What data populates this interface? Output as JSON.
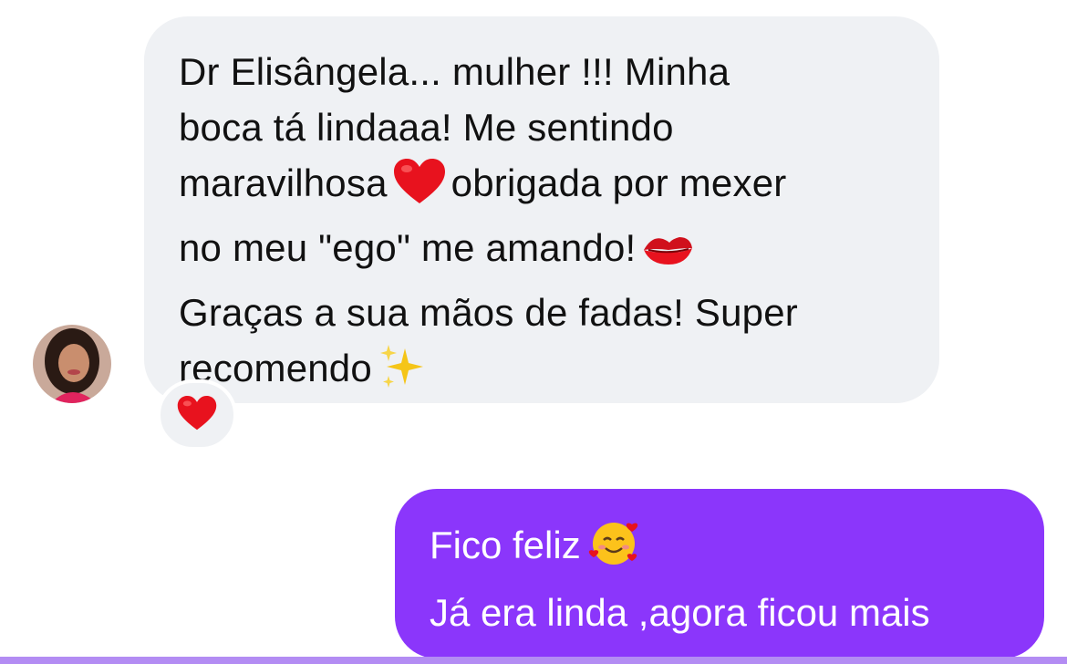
{
  "incoming_message": {
    "lines": [
      "Dr Elisângela... mulher !!! Minha",
      "boca tá lindaaa! Me sentindo",
      "maravilhosa",
      "obrigada por mexer",
      "no meu \"ego\" me amando!",
      "Graças a sua mãos de fadas! Super",
      "recomendo"
    ],
    "emojis": [
      "red-heart",
      "kiss-mark",
      "sparkles"
    ]
  },
  "reaction": {
    "emoji": "red-heart"
  },
  "outgoing_message": {
    "lines": [
      "Fico feliz",
      "Já era linda ,agora ficou mais"
    ],
    "emoji": "smiling-face-with-hearts"
  },
  "colors": {
    "incoming_bubble": "#eff1f4",
    "outgoing_bubble": "#8b36fb",
    "heart": "#e8121e",
    "background": "#ffffff"
  }
}
